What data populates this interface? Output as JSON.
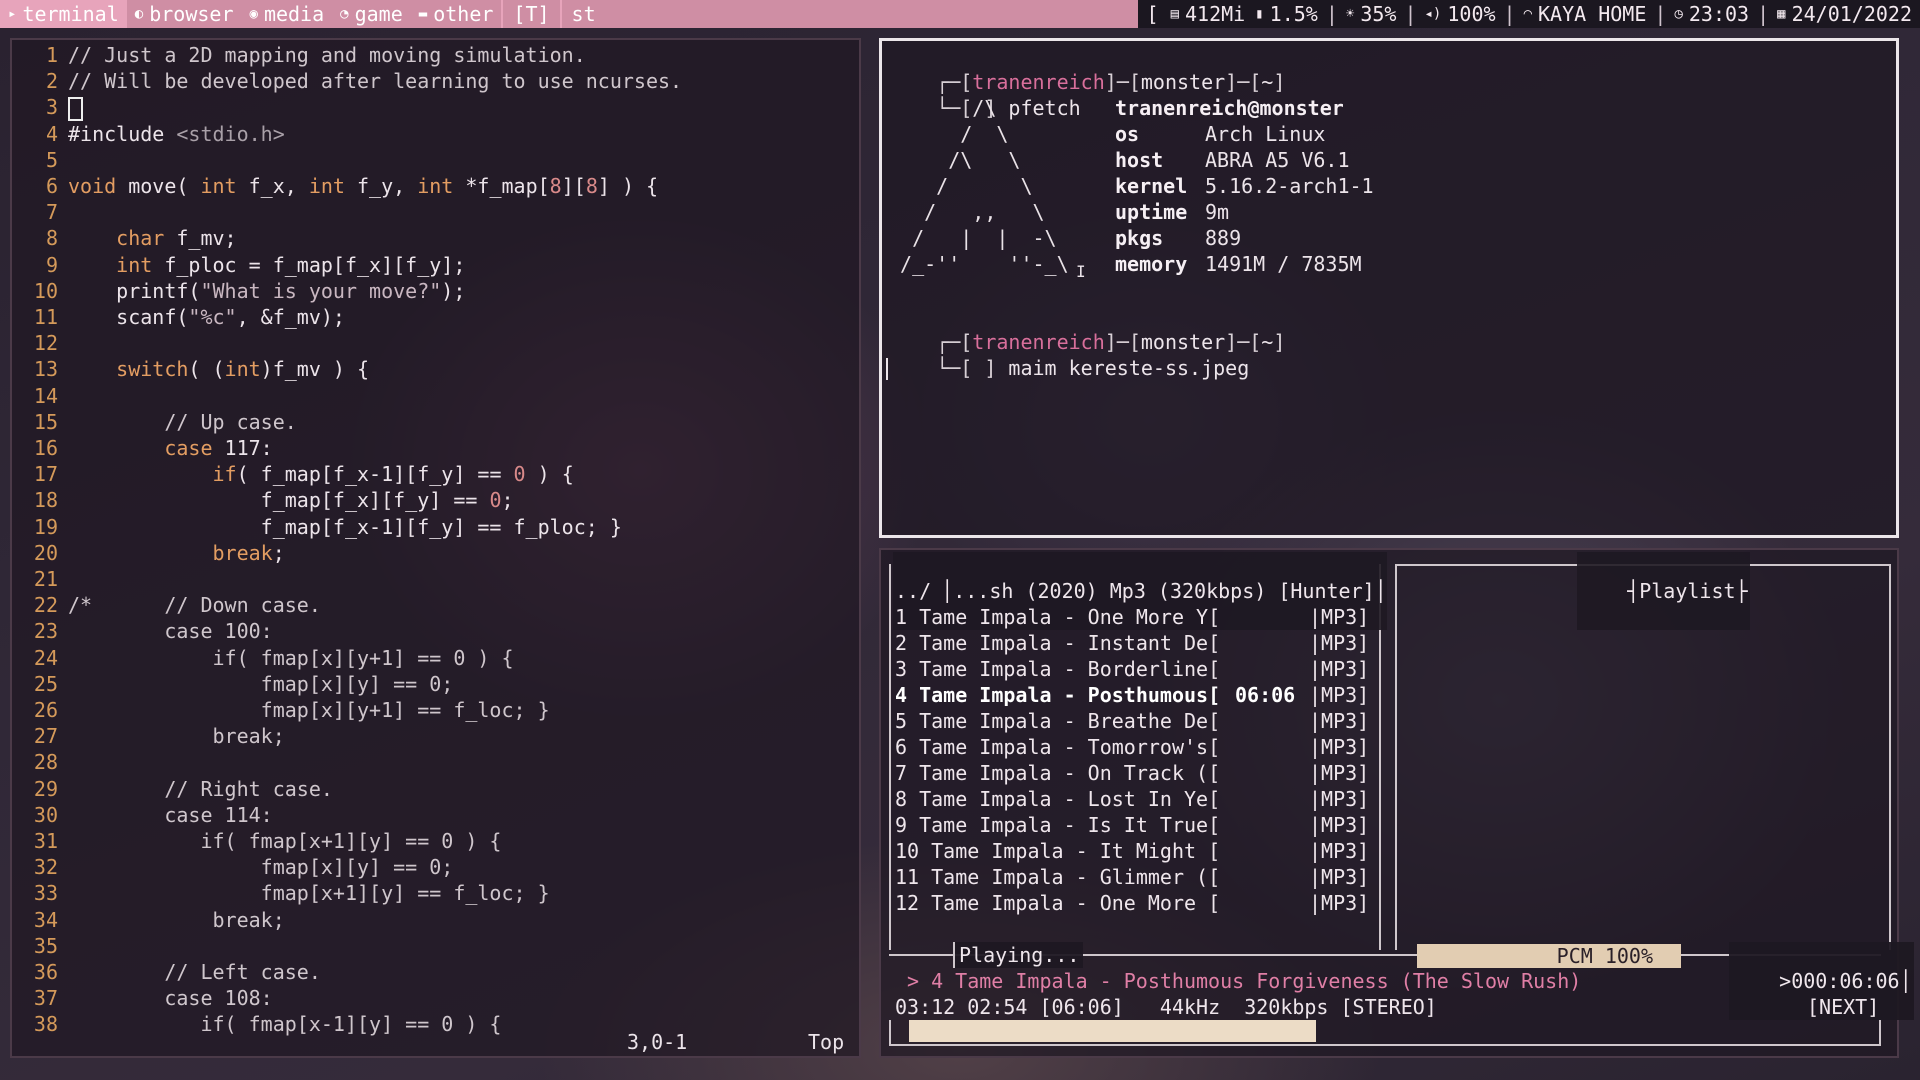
{
  "topbar": {
    "workspaces": [
      {
        "label": "terminal",
        "icon": "terminal-icon",
        "glyph": "▸",
        "active": true
      },
      {
        "label": "browser",
        "icon": "browser-icon",
        "glyph": "◐",
        "active": false
      },
      {
        "label": "media",
        "icon": "media-icon",
        "glyph": "◉",
        "active": false
      },
      {
        "label": "game",
        "icon": "gamepad-icon",
        "glyph": "◔",
        "active": false
      },
      {
        "label": "other",
        "icon": "folder-icon",
        "glyph": "▬",
        "active": false
      }
    ],
    "layout": "[T]",
    "window_title": "st",
    "status": {
      "memory": "412Mi",
      "cpu": "1.5%",
      "brightness": "35%",
      "volume": "100%",
      "wifi": "KAYA HOME",
      "time": "23:03",
      "date": "24/01/2022"
    }
  },
  "editor": {
    "lines": [
      "// Just a 2D mapping and moving simulation.",
      "// Will be developed after learning to use ncurses.",
      "",
      "#include <stdio.h>",
      "",
      "void move( int f_x, int f_y, int *f_map[8][8] ) {",
      "",
      "    char f_mv;",
      "    int f_ploc = f_map[f_x][f_y];",
      "    printf(\"What is your move?\");",
      "    scanf(\"%c\", &f_mv);",
      "",
      "    switch( (int)f_mv ) {",
      "",
      "        // Up case.",
      "        case 117:",
      "            if( f_map[f_x-1][f_y] == 0 ) {",
      "                f_map[f_x][f_y] == 0;",
      "                f_map[f_x-1][f_y] == f_ploc; }",
      "            break;",
      "",
      "/*      // Down case.",
      "        case 100:",
      "            if( fmap[x][y+1] == 0 ) {",
      "                fmap[x][y] == 0;",
      "                fmap[x][y+1] == f_loc; }",
      "            break;",
      "",
      "        // Right case.",
      "        case 114:",
      "           if( fmap[x+1][y] == 0 ) {",
      "                fmap[x][y] == 0;",
      "                fmap[x+1][y] == f_loc; }",
      "            break;",
      "",
      "        // Left case.",
      "        case 108:",
      "           if( fmap[x-1][y] == 0 ) {"
    ],
    "ruler_position": "3,0-1",
    "ruler_scroll": "Top"
  },
  "terminal": {
    "prompt_user": "tranenreich",
    "prompt_host": "monster",
    "prompt_dir": "~",
    "cmd1": "pfetch",
    "cmd2": "maim kereste-ss.jpeg",
    "ascii_art": [
      "       /\\",
      "      /  \\",
      "     /\\   \\",
      "    /      \\",
      "   /   ,,   \\",
      "  /   |  |  -\\",
      " /_-''    ''-_\\"
    ],
    "fetch_title": "tranenreich@monster",
    "fetch": [
      {
        "key": "os",
        "value": "Arch Linux"
      },
      {
        "key": "host",
        "value": "ABRA A5 V6.1"
      },
      {
        "key": "kernel",
        "value": "5.16.2-arch1-1"
      },
      {
        "key": "uptime",
        "value": "9m"
      },
      {
        "key": "pkgs",
        "value": "889"
      },
      {
        "key": "memory",
        "value": "1491M / 7835M"
      }
    ]
  },
  "music": {
    "browser_title": "...sh (2020) Mp3 (320kbps) [Hunter]",
    "parent_dir": "../",
    "tracks": [
      {
        "name": "1 Tame Impala - One More Y[",
        "time": "",
        "type": "|MP3]"
      },
      {
        "name": "2 Tame Impala - Instant De[",
        "time": "",
        "type": "|MP3]"
      },
      {
        "name": "3 Tame Impala - Borderline[",
        "time": "",
        "type": "|MP3]"
      },
      {
        "name": "4 Tame Impala - Posthumous[",
        "time": "06:06",
        "type": "|MP3]",
        "playing": true
      },
      {
        "name": "5 Tame Impala - Breathe De[",
        "time": "",
        "type": "|MP3]"
      },
      {
        "name": "6 Tame Impala - Tomorrow's[",
        "time": "",
        "type": "|MP3]"
      },
      {
        "name": "7 Tame Impala - On Track ([",
        "time": "",
        "type": "|MP3]"
      },
      {
        "name": "8 Tame Impala - Lost In Ye[",
        "time": "",
        "type": "|MP3]"
      },
      {
        "name": "9 Tame Impala - Is It True[",
        "time": "",
        "type": "|MP3]"
      },
      {
        "name": "10 Tame Impala - It Might [",
        "time": "",
        "type": "|MP3]"
      },
      {
        "name": "11 Tame Impala - Glimmer ([",
        "time": "",
        "type": "|MP3]"
      },
      {
        "name": "12 Tame Impala - One More [",
        "time": "",
        "type": "|MP3]"
      }
    ],
    "playlist_title": "Playlist",
    "status_label": "Playing...",
    "pcm": "PCM 100%",
    "total_time": ">000:06:06",
    "now_playing": "> 4 Tame Impala - Posthumous Forgiveness (The Slow Rush)",
    "info": "03:12 02:54 [06:06]   44kHz  320kbps [STEREO]",
    "next_label": "[NEXT]",
    "progress": 0.42
  }
}
